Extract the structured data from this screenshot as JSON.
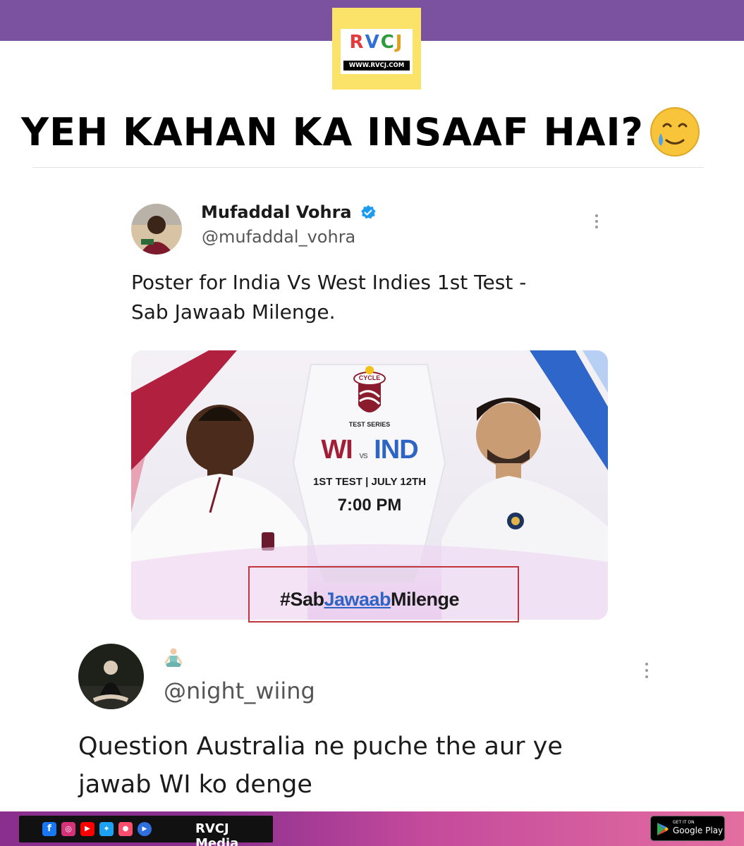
{
  "brand": {
    "logo_letters": "RVCJ",
    "logo_url": "WWW.RVCJ.COM",
    "accent_purple": "#7b52a0",
    "accent_yellow": "#fbe36a"
  },
  "headline": {
    "text": "YEH KAHAN KA INSAAF HAI?",
    "emoji_icon": "smiling-face-with-tear-icon"
  },
  "tweet1": {
    "name": "Mufaddal Vohra",
    "handle": "@mufaddal_vohra",
    "verified": true,
    "text_line1": "Poster for India Vs West Indies 1st Test -",
    "text_line2": "Sab Jawaab Milenge."
  },
  "poster": {
    "logo_text": "CYCLE",
    "series": "TEST SERIES",
    "team1": "WI",
    "vs": "VS",
    "team2": "IND",
    "match_info": "1ST TEST | JULY 12TH",
    "time": "7:00 PM",
    "hashtag_part1": "#Sab",
    "hashtag_part2": "Jawaab",
    "hashtag_part3": "Milenge"
  },
  "tweet2": {
    "name_emoji_icon": "person-in-lotus-position-icon",
    "handle": "@night_wiing",
    "text_line1": "Question Australia ne puche the aur ye",
    "text_line2": "jawab WI ko denge"
  },
  "footer": {
    "social_icons": [
      "facebook-icon",
      "instagram-icon",
      "youtube-icon",
      "twitter-icon",
      "moj-icon",
      "play-icon"
    ],
    "brand_name": "RVCJ Media",
    "store_small": "GET IT ON",
    "store_big": "Google Play"
  }
}
